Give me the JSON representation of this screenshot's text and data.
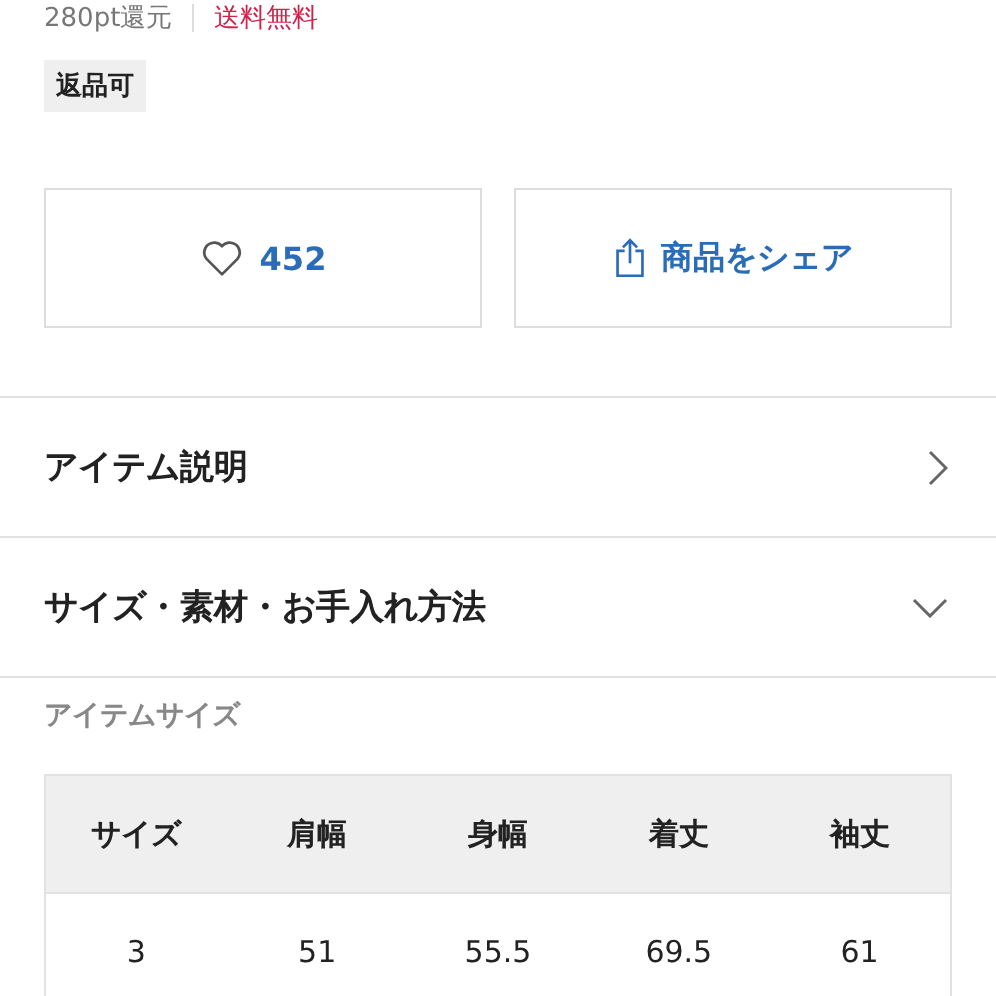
{
  "info_row": {
    "points": "280pt還元",
    "shipping": "送料無料"
  },
  "tags": [
    "返品可"
  ],
  "actions": [
    {
      "kind": "like",
      "label": "452"
    },
    {
      "kind": "share",
      "label": "商品をシェア"
    }
  ],
  "sections": [
    {
      "title": "アイテム説明",
      "expanded": false
    },
    {
      "title": "サイズ・素材・お手入れ方法",
      "expanded": true
    }
  ],
  "size_table": {
    "title": "アイテムサイズ",
    "columns": [
      "サイズ",
      "肩幅",
      "身幅",
      "着丈",
      "袖丈"
    ],
    "rows": [
      [
        "3",
        "51",
        "55.5",
        "69.5",
        "61"
      ]
    ]
  }
}
